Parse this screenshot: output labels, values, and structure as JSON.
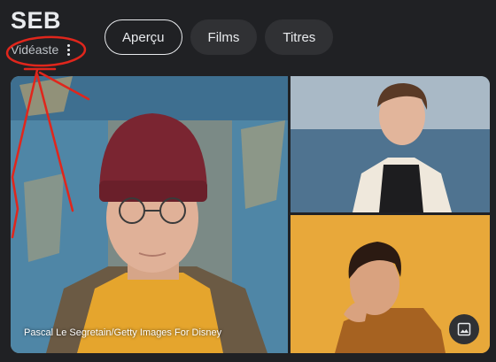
{
  "header": {
    "title": "SEB",
    "subtitle": "Vidéaste",
    "more_icon": "more-vert-icon"
  },
  "tabs": [
    {
      "label": "Aperçu",
      "active": true
    },
    {
      "label": "Films",
      "active": false
    },
    {
      "label": "Titres",
      "active": false
    }
  ],
  "gallery": {
    "main_credit": "Pascal Le Segretain/Getty Images For Disney",
    "images_button_icon": "image-icon"
  },
  "colors": {
    "background": "#202124",
    "annotation": "#e0261c"
  }
}
